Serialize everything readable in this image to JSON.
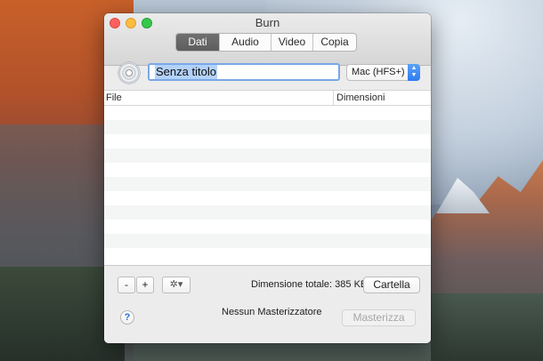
{
  "window": {
    "title": "Burn"
  },
  "tabs": [
    {
      "label": "Dati",
      "active": true
    },
    {
      "label": "Audio",
      "active": false
    },
    {
      "label": "Video",
      "active": false
    },
    {
      "label": "Copia",
      "active": false
    }
  ],
  "disc": {
    "icon": "cd-disc-icon",
    "name_value": "Senza titolo"
  },
  "filesystem": {
    "selected": "Mac (HFS+)"
  },
  "table": {
    "columns": [
      "File",
      "Dimensioni"
    ],
    "rows": []
  },
  "footer": {
    "remove_label": "-",
    "add_label": "+",
    "gear_icon": "gear-icon",
    "gear_label": "✲▾",
    "total_label": "Dimensione totale: 385 KB",
    "folder_label": "Cartella",
    "help_label": "?",
    "recorder_status": "Nessun Masterizzatore",
    "burn_label": "Masterizza"
  },
  "colors": {
    "accent": "#2e7cf0",
    "selection": "#b3d2fa",
    "close": "#fc605c",
    "minimize": "#fdbc40",
    "maximize": "#34c84a"
  }
}
